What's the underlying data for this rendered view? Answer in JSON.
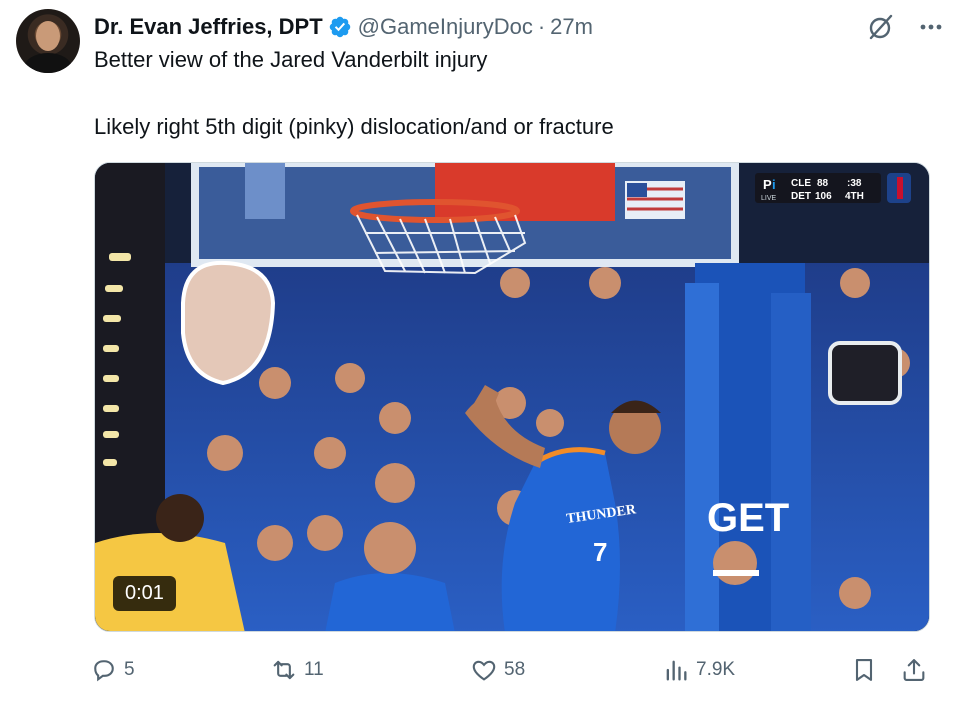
{
  "author": {
    "display_name": "Dr. Evan Jeffries, DPT",
    "handle": "@GameInjuryDoc",
    "separator": "·",
    "time": "27m"
  },
  "icons": {
    "verified": "verified-badge-icon",
    "grok": "grok-icon",
    "more": "more-icon",
    "reply": "reply-icon",
    "retweet": "retweet-icon",
    "like": "like-icon",
    "views": "views-icon",
    "bookmark": "bookmark-icon",
    "share": "share-icon"
  },
  "tweet": {
    "line1": "Better view of the Jared Vanderbilt injury",
    "line2": "Likely right 5th digit (pinky) dislocation/and or fracture"
  },
  "media": {
    "duration": "0:01",
    "scorebug": {
      "team1": "CLE",
      "score1": "88",
      "team2": "DET",
      "score2": "106",
      "clock": ":38",
      "period": "4TH",
      "live": "LIVE"
    },
    "jersey_text": "THUNDER",
    "jersey_number": "7",
    "sign_text": "GET"
  },
  "metrics": {
    "replies": "5",
    "retweets": "11",
    "likes": "58",
    "views": "7.9K"
  },
  "colors": {
    "verified": "#1d9bf0",
    "text": "#0f1419",
    "muted": "#536471",
    "thunder_blue": "#2266d6"
  }
}
